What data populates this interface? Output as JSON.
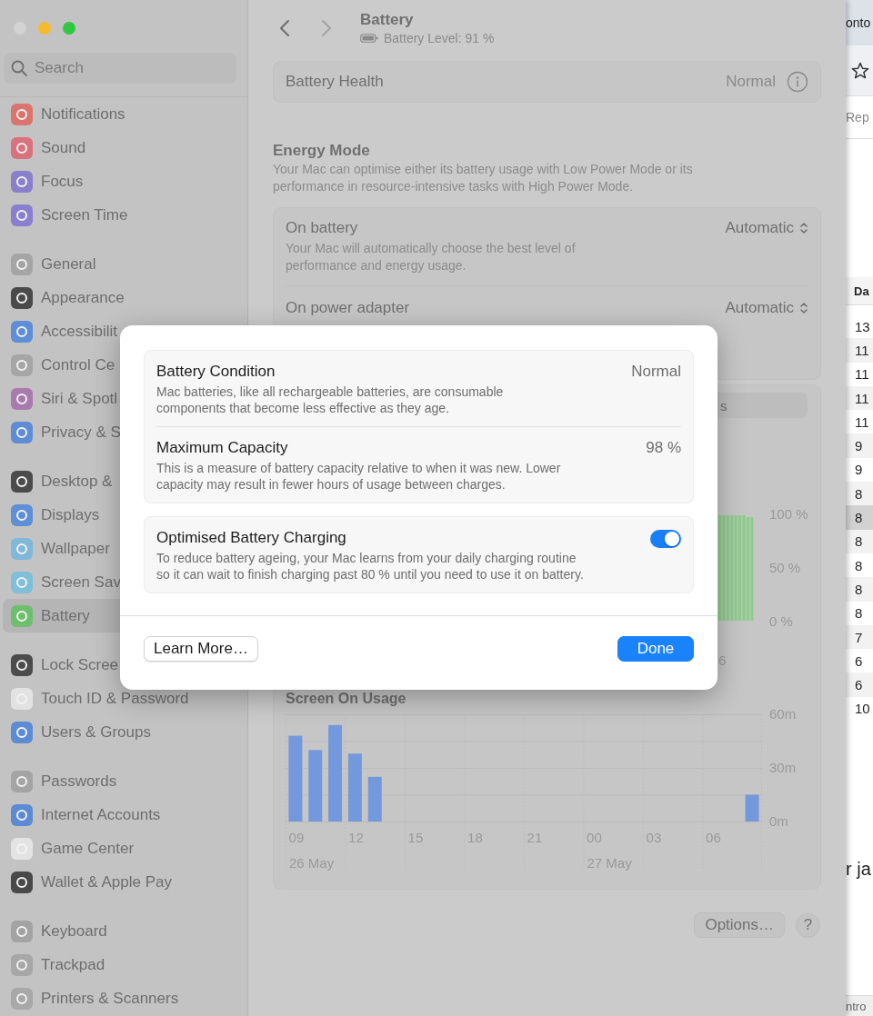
{
  "window": {
    "title": "Battery",
    "subtitle": "Battery Level: 91 %"
  },
  "nav": [
    {
      "kind": "back",
      "disabled": false
    },
    {
      "kind": "forward",
      "disabled": true
    }
  ],
  "sidebar": {
    "search": {
      "placeholder": "Search"
    },
    "groups": [
      {
        "items": [
          {
            "label": "Notifications",
            "color": "#d9756e",
            "selected": false
          },
          {
            "label": "Sound",
            "color": "#d9727e",
            "selected": false
          },
          {
            "label": "Focus",
            "color": "#8a80c9",
            "selected": false
          },
          {
            "label": "Screen Time",
            "color": "#8a7fcf",
            "selected": false
          }
        ]
      },
      {
        "items": [
          {
            "label": "General",
            "color": "#a5a5a5",
            "selected": false
          },
          {
            "label": "Appearance",
            "color": "#4a4a4a",
            "selected": false
          },
          {
            "label": "Accessibilit",
            "color": "#5f8ed6",
            "selected": false
          },
          {
            "label": "Control Ce",
            "color": "#a6a6a6",
            "selected": false
          },
          {
            "label": "Siri & Spotl",
            "color": "#a97aae",
            "selected": false
          },
          {
            "label": "Privacy & S",
            "color": "#5e8dd5",
            "selected": false
          }
        ]
      },
      {
        "items": [
          {
            "label": "Desktop &",
            "color": "#4b4b4b",
            "selected": false
          },
          {
            "label": "Displays",
            "color": "#5f8fd6",
            "selected": false
          },
          {
            "label": "Wallpaper",
            "color": "#7fb8d8",
            "selected": false
          },
          {
            "label": "Screen Sav",
            "color": "#7fc0d8",
            "selected": false
          },
          {
            "label": "Battery",
            "color": "#6cbf6c",
            "selected": true
          }
        ]
      },
      {
        "items": [
          {
            "label": "Lock Scree",
            "color": "#4c4c4c",
            "selected": false
          },
          {
            "label": "Touch ID & Password",
            "color": "#e2e2e2",
            "selected": false
          },
          {
            "label": "Users & Groups",
            "color": "#5d8cd4",
            "selected": false
          }
        ]
      },
      {
        "items": [
          {
            "label": "Passwords",
            "color": "#a4a4a4",
            "selected": false
          },
          {
            "label": "Internet Accounts",
            "color": "#5c8bd3",
            "selected": false
          },
          {
            "label": "Game Center",
            "color": "#e3e3e3",
            "selected": false
          },
          {
            "label": "Wallet & Apple Pay",
            "color": "#494949",
            "selected": false
          }
        ]
      },
      {
        "items": [
          {
            "label": "Keyboard",
            "color": "#a3a3a3",
            "selected": false
          },
          {
            "label": "Trackpad",
            "color": "#a7a7a7",
            "selected": false
          },
          {
            "label": "Printers & Scanners",
            "color": "#a8a8a8",
            "selected": false
          }
        ]
      }
    ]
  },
  "battery_health": {
    "label": "Battery Health",
    "value": "Normal"
  },
  "energy_mode": {
    "heading": "Energy Mode",
    "description": "Your Mac can optimise either its battery usage with Low Power Mode or its performance in resource-intensive tasks with High Power Mode.",
    "rows": [
      {
        "label": "On battery",
        "description": "Your Mac will automatically choose the best level of performance and energy usage.",
        "value": "Automatic"
      },
      {
        "label": "On power adapter",
        "value": "Automatic"
      }
    ]
  },
  "range_control": {
    "label": "s"
  },
  "battery_level_chart": {
    "y_labels": [
      "100 %",
      "50 %",
      "0 %"
    ],
    "x_label": "6"
  },
  "screen_on_usage": {
    "heading": "Screen On Usage",
    "chart_data": {
      "type": "bar",
      "x": [
        9,
        10,
        11,
        12,
        13,
        32
      ],
      "values": [
        48,
        40,
        54,
        38,
        25,
        15
      ],
      "xlim": [
        8.5,
        32.5
      ],
      "ylim": [
        0,
        60
      ],
      "xticks": [
        {
          "value": 9,
          "label": "09"
        },
        {
          "value": 12,
          "label": "12"
        },
        {
          "value": 15,
          "label": "15"
        },
        {
          "value": 18,
          "label": "18"
        },
        {
          "value": 21,
          "label": "21"
        }
      ],
      "yticks": [
        {
          "value": 0,
          "label": "0m"
        },
        {
          "value": 30,
          "label": "30m"
        },
        {
          "value": 60,
          "label": "60m"
        }
      ]
    },
    "next_day_labels": [
      "00",
      "03",
      "06"
    ],
    "dates": [
      "26 May",
      "27 May"
    ]
  },
  "footer": {
    "options": "Options…",
    "help": "?"
  },
  "dialog": {
    "rows": [
      {
        "title": "Battery Condition",
        "value": "Normal",
        "description": "Mac batteries, like all rechargeable batteries, are consumable components that become less effective as they age."
      },
      {
        "title": "Maximum Capacity",
        "value": "98 %",
        "description": "This is a measure of battery capacity relative to when it was new. Lower capacity may result in fewer hours of usage between charges."
      }
    ],
    "charging": {
      "title": "Optimised Battery Charging",
      "description": "To reduce battery ageing, your Mac learns from your daily charging routine so it can wait to finish charging past 80 % until you need to use it on battery.",
      "on": true
    },
    "buttons": [
      {
        "label": "Learn More…",
        "kind": "secondary"
      },
      {
        "label": "Done",
        "kind": "primary"
      }
    ]
  },
  "background_window": {
    "title": "onto",
    "tab": "Rep",
    "column": "Da",
    "rows": [
      {
        "value": "13",
        "selected": false
      },
      {
        "value": "11",
        "selected": false
      },
      {
        "value": "11",
        "selected": false
      },
      {
        "value": "11",
        "selected": false
      },
      {
        "value": "11",
        "selected": false
      },
      {
        "value": "9",
        "selected": false
      },
      {
        "value": "9",
        "selected": false
      },
      {
        "value": "8",
        "selected": false
      },
      {
        "value": "8",
        "selected": true
      },
      {
        "value": "8",
        "selected": false
      },
      {
        "value": "8",
        "selected": false
      },
      {
        "value": "8",
        "selected": false
      },
      {
        "value": "8",
        "selected": false
      },
      {
        "value": "7",
        "selected": false
      },
      {
        "value": "6",
        "selected": false
      },
      {
        "value": "6",
        "selected": false
      },
      {
        "value": "10",
        "selected": false
      }
    ],
    "text": "r ja",
    "status": "ntro"
  }
}
